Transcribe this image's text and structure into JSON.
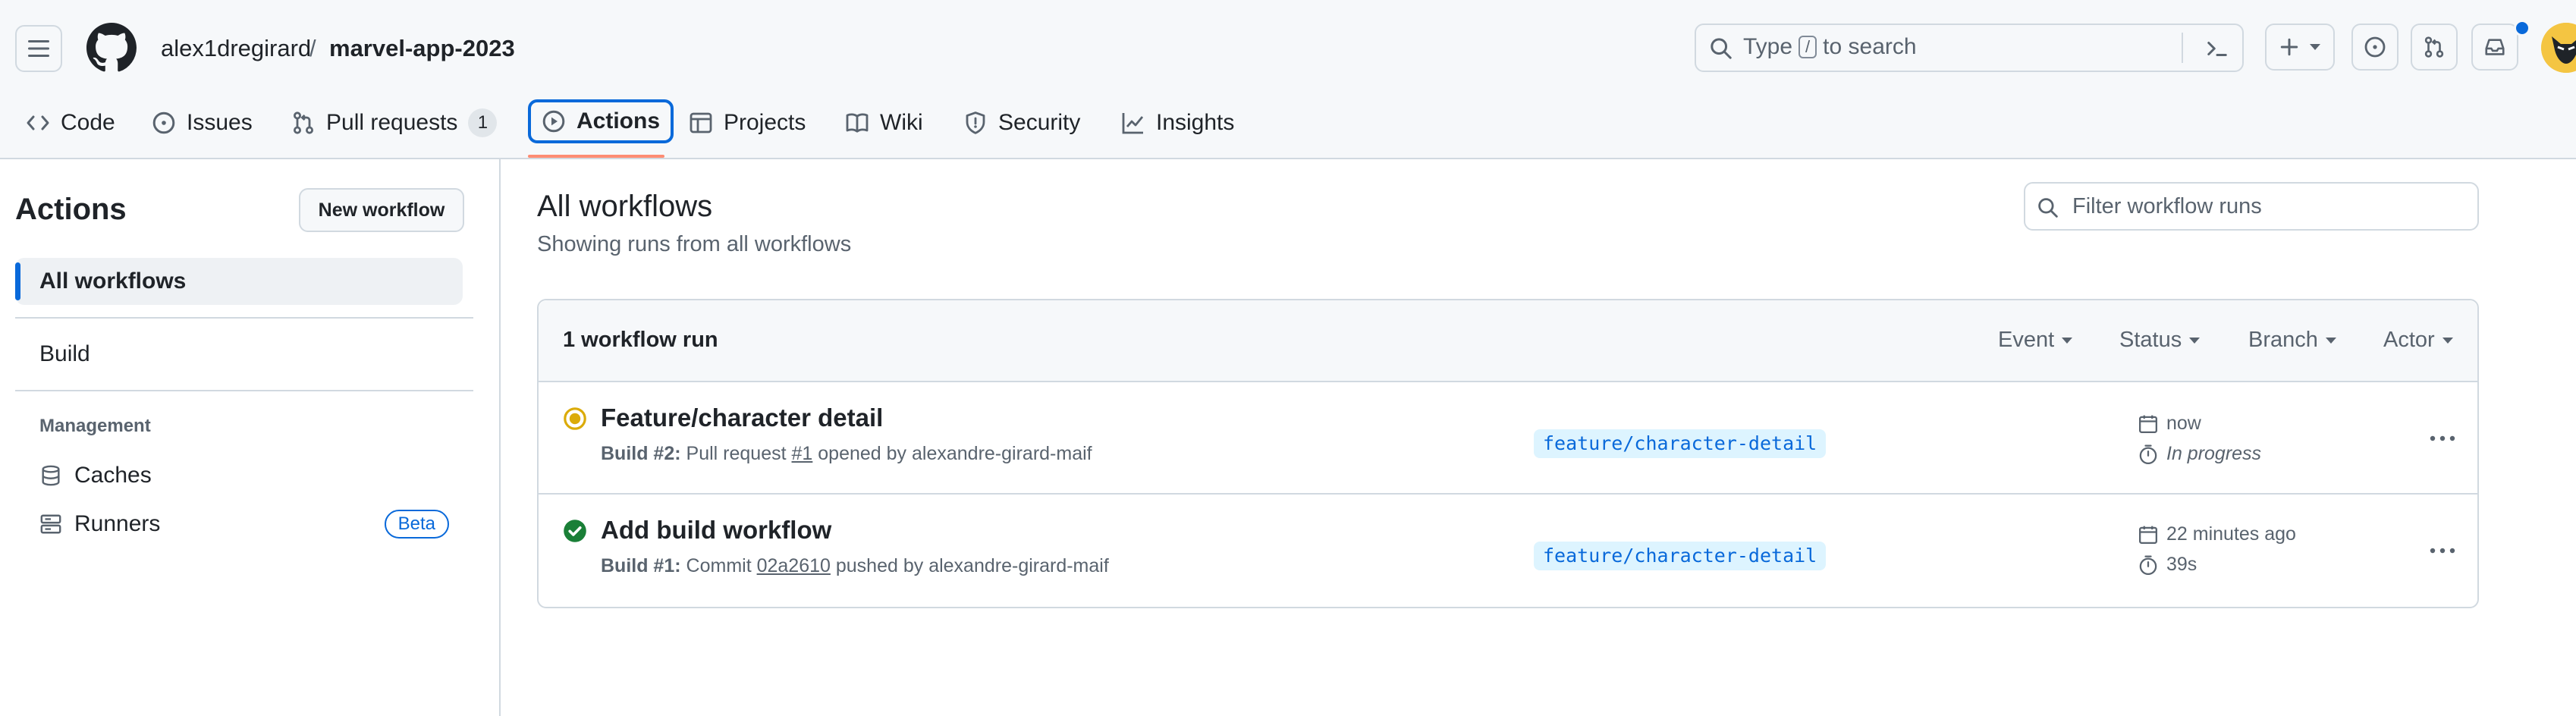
{
  "header": {
    "owner": "alex1dregirard",
    "separator": "/",
    "repo": "marvel-app-2023",
    "search": {
      "prefix": "Type",
      "key": "/",
      "suffix": "to search"
    }
  },
  "tabs": [
    {
      "label": "Code",
      "icon": "code-icon"
    },
    {
      "label": "Issues",
      "icon": "issue-icon"
    },
    {
      "label": "Pull requests",
      "icon": "pull-request-icon",
      "count": "1"
    },
    {
      "label": "Actions",
      "icon": "play-icon",
      "active": true
    },
    {
      "label": "Projects",
      "icon": "table-icon"
    },
    {
      "label": "Wiki",
      "icon": "book-icon"
    },
    {
      "label": "Security",
      "icon": "shield-icon"
    },
    {
      "label": "Insights",
      "icon": "graph-icon"
    }
  ],
  "sidebar": {
    "title": "Actions",
    "new_workflow": "New workflow",
    "items": [
      "All workflows",
      "Build"
    ],
    "management_label": "Management",
    "management": [
      {
        "label": "Caches",
        "icon": "database-icon"
      },
      {
        "label": "Runners",
        "icon": "server-icon",
        "badge": "Beta"
      }
    ]
  },
  "main": {
    "title": "All workflows",
    "subtitle": "Showing runs from all workflows",
    "filter_placeholder": "Filter workflow runs",
    "run_count": "1 workflow run",
    "filters": [
      "Event",
      "Status",
      "Branch",
      "Actor"
    ],
    "runs": [
      {
        "title": "Feature/character detail",
        "status": "in-progress",
        "meta_build": "Build #2:",
        "meta_a": "Pull request",
        "meta_ref": "#1",
        "meta_b": "opened by alexandre-girard-maif",
        "branch": "feature/character-detail",
        "date": "now",
        "duration": "In progress"
      },
      {
        "title": "Add build workflow",
        "status": "success",
        "meta_build": "Build #1:",
        "meta_a": "Commit",
        "meta_ref": "02a2610",
        "meta_b": "pushed by alexandre-girard-maif",
        "branch": "feature/character-detail",
        "date": "22 minutes ago",
        "duration": "39s"
      }
    ]
  },
  "colors": {
    "accent": "#0969da",
    "success": "#1a7f37",
    "in_progress": "#dbab09",
    "tab_underline": "#fd8c73"
  }
}
